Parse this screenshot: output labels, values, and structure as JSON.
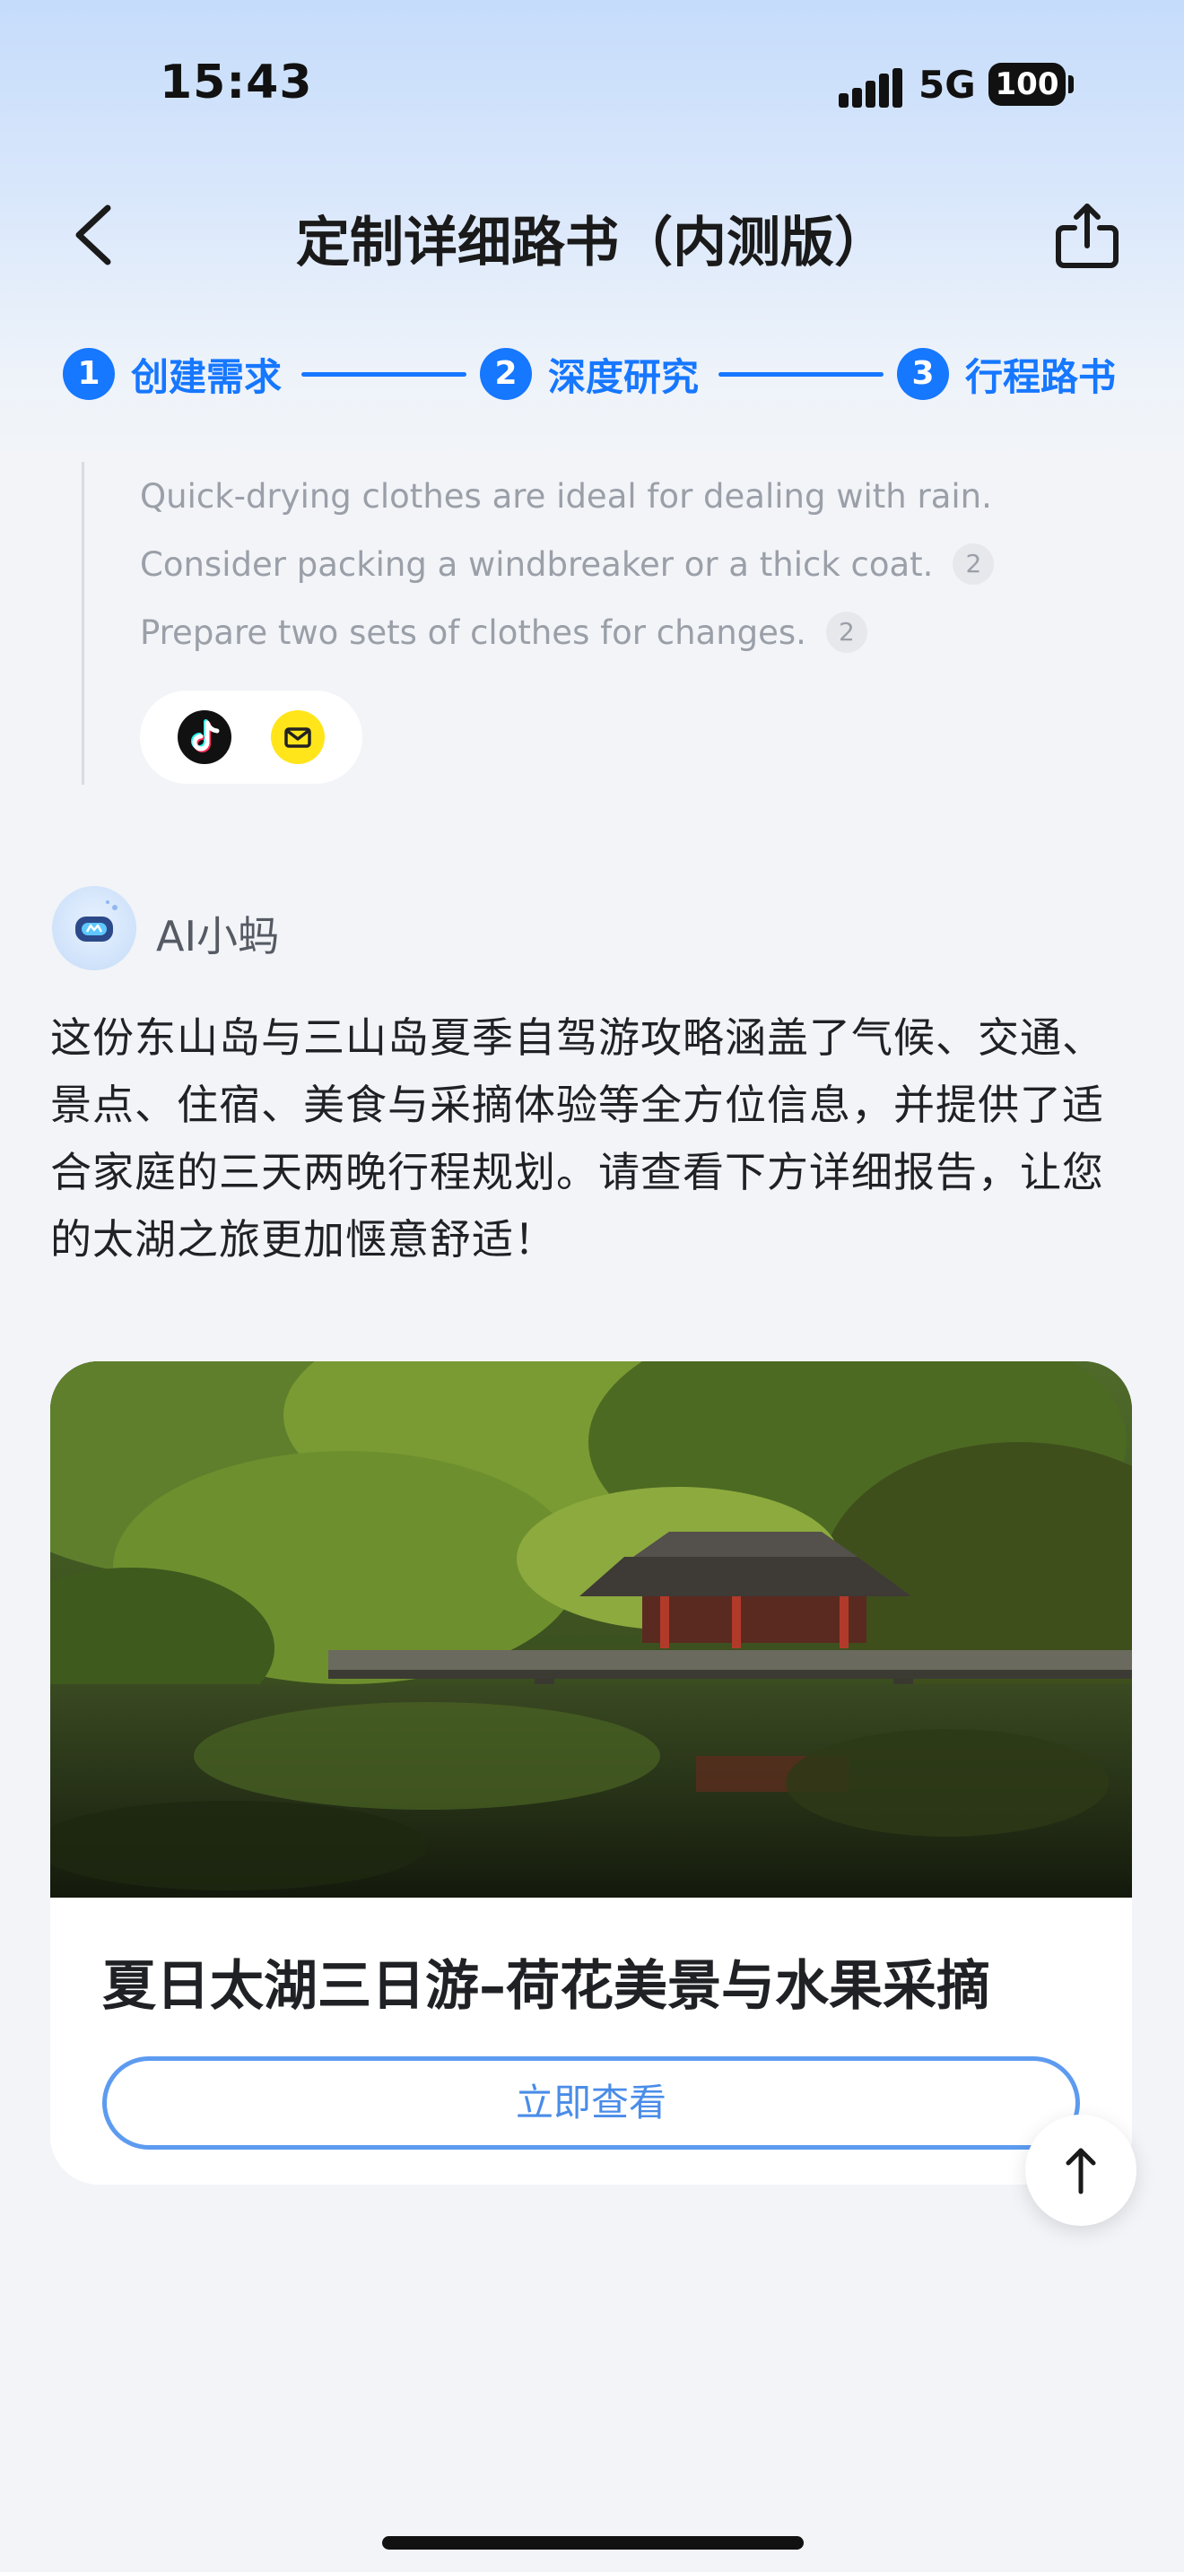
{
  "status_bar": {
    "time": "15:43",
    "network": "5G",
    "battery": "100"
  },
  "header": {
    "title": "定制详细路书（内测版）",
    "back_icon": "chevron-left-icon",
    "share_icon": "share-icon"
  },
  "steps": [
    {
      "number": "1",
      "label": "创建需求"
    },
    {
      "number": "2",
      "label": "深度研究"
    },
    {
      "number": "3",
      "label": "行程路书"
    }
  ],
  "research_notes": {
    "lines": [
      {
        "text": "Quick-drying clothes are ideal for dealing with rain.",
        "citation": ""
      },
      {
        "text": "Consider packing a windbreaker or a thick coat.",
        "citation": "2"
      },
      {
        "text": "Prepare two sets of clothes for changes.",
        "citation": "2"
      }
    ],
    "sources": [
      "tiktok-icon",
      "mail-app-icon"
    ]
  },
  "assistant": {
    "name": "AI小蚂",
    "message": "这份东山岛与三山岛夏季自驾游攻略涵盖了气候、交通、景点、住宿、美食与采摘体验等全方位信息，并提供了适合家庭的三天两晚行程规划。请查看下方详细报告，让您的太湖之旅更加惬意舒适！"
  },
  "report_card": {
    "title": "夏日太湖三日游–荷花美景与水果采摘",
    "button_label": "立即查看"
  },
  "colors": {
    "accent": "#1677ff",
    "button_border": "#5d9bf0"
  }
}
